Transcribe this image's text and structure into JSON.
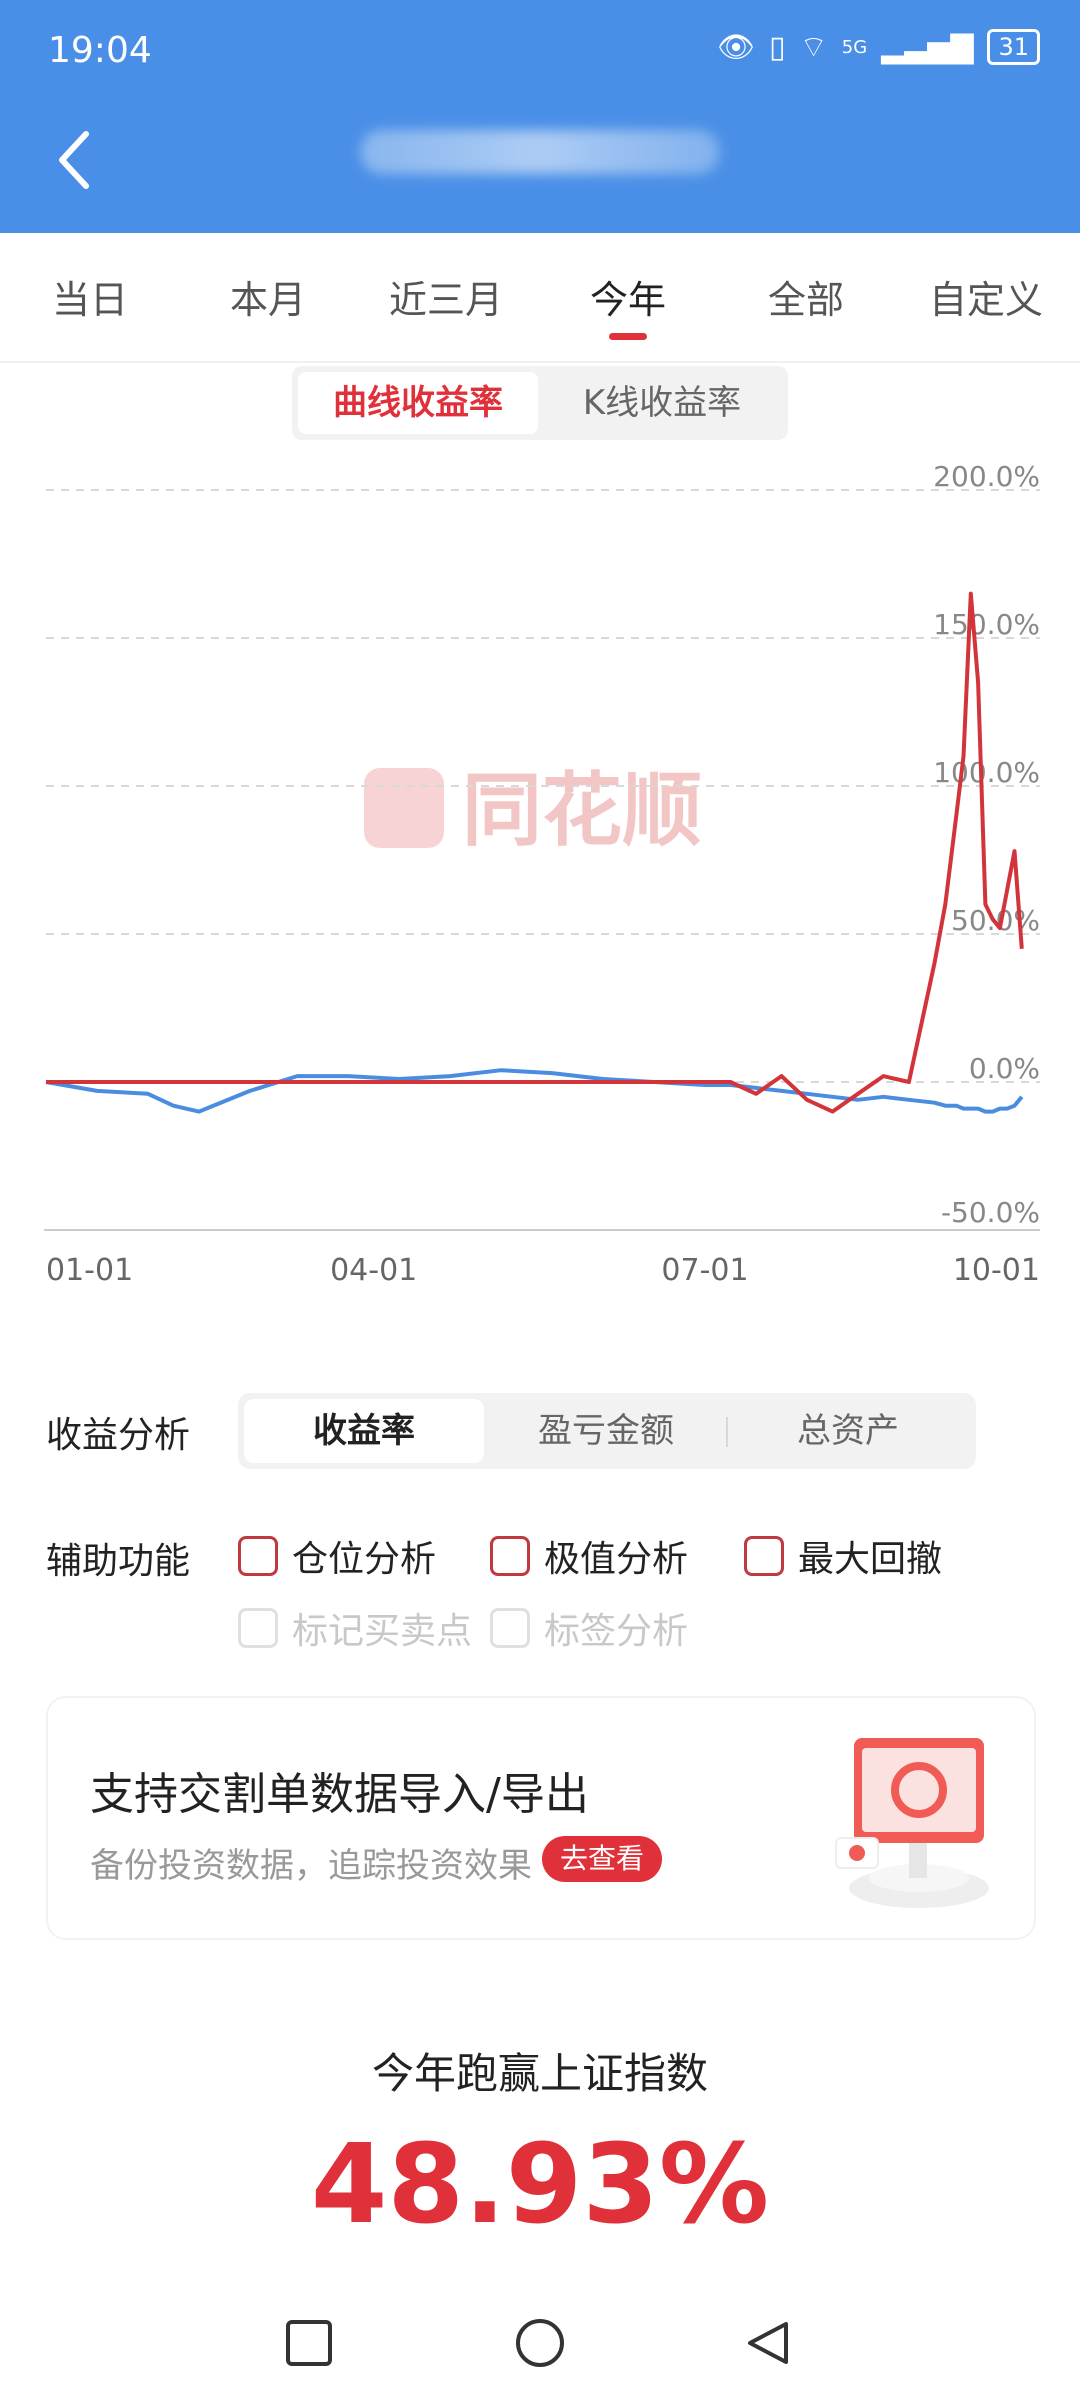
{
  "status_bar": {
    "time": "19:04",
    "network": "5G",
    "battery": "31"
  },
  "tabs": [
    {
      "label": "当日"
    },
    {
      "label": "本月"
    },
    {
      "label": "近三月"
    },
    {
      "label": "今年"
    },
    {
      "label": "全部"
    },
    {
      "label": "自定义"
    }
  ],
  "active_tab": "今年",
  "chart_mode": {
    "options": [
      "曲线收益率",
      "K线收益率"
    ],
    "active": "曲线收益率"
  },
  "watermark": "同花顺",
  "chart_data": {
    "type": "line",
    "ylim": [
      -50,
      200
    ],
    "y_ticks": [
      "200.0%",
      "150.0%",
      "100.0%",
      "50.0%",
      "0.0%",
      "-50.0%"
    ],
    "x_ticks": [
      "01-01",
      "04-01",
      "07-01",
      "10-01"
    ],
    "grid": true,
    "x": [
      "01-01",
      "01-15",
      "01-29",
      "02-05",
      "02-12",
      "02-26",
      "03-11",
      "03-25",
      "04-08",
      "04-22",
      "05-06",
      "05-20",
      "06-03",
      "06-17",
      "07-01",
      "07-08",
      "07-15",
      "07-22",
      "07-29",
      "08-05",
      "08-12",
      "08-19",
      "08-26",
      "09-02",
      "09-05",
      "09-08",
      "09-10",
      "09-12",
      "09-14",
      "09-16",
      "09-18",
      "09-20",
      "09-22",
      "09-24",
      "09-26",
      "09-28",
      "10-01"
    ],
    "series": [
      {
        "color": "#d2343a",
        "values": [
          0,
          0,
          0,
          0,
          0,
          0,
          0,
          0,
          0,
          0,
          0,
          0,
          0,
          0,
          0,
          0,
          -4,
          2,
          -6,
          -10,
          -4,
          2,
          0,
          40,
          60,
          90,
          110,
          165,
          135,
          60,
          55,
          52,
          65,
          78,
          45,
          null,
          null
        ]
      },
      {
        "color": "#4a8de0",
        "values": [
          0,
          -3,
          -4,
          -8,
          -10,
          -3,
          2,
          2,
          1,
          2,
          4,
          3,
          1,
          0,
          -1,
          -1,
          -2,
          -3,
          -4,
          -5,
          -6,
          -5,
          -6,
          -7,
          -8,
          -8,
          -9,
          -9,
          -9,
          -10,
          -10,
          -9,
          -9,
          -8,
          -5,
          null,
          null
        ]
      }
    ]
  },
  "analysis": {
    "label": "收益分析",
    "options": [
      "收益率",
      "盈亏金额",
      "总资产"
    ],
    "active": "收益率"
  },
  "aux": {
    "label": "辅助功能",
    "checkboxes": [
      "仓位分析",
      "极值分析",
      "最大回撤"
    ],
    "disabled": [
      "标记买卖点",
      "标签分析"
    ]
  },
  "promo": {
    "title": "支持交割单数据导入/导出",
    "subtitle": "备份投资数据，追踪投资效果",
    "button": "去查看"
  },
  "summary": {
    "label": "今年跑赢上证指数",
    "value": "48.93%"
  },
  "colors": {
    "header_bg": "#4a8fe7",
    "accent_red": "#e0303a",
    "series_red": "#d2343a",
    "series_blue": "#4a8de0"
  }
}
